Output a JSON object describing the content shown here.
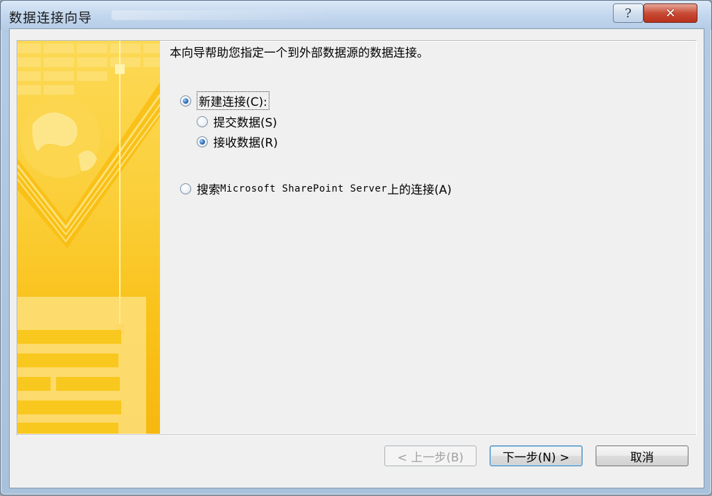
{
  "window": {
    "title": "数据连接向导",
    "help_label": "?",
    "close_label": "✕"
  },
  "wizard": {
    "intro": "本向导帮助您指定一个到外部数据源的数据连接。",
    "options": {
      "new_connection": "新建连接(C):",
      "submit_data": "提交数据(S)",
      "receive_data": "接收数据(R)",
      "search_prefix": "搜索 ",
      "search_product": "Microsoft SharePoint Server",
      "search_suffix": " 上的连接(A)"
    }
  },
  "buttons": {
    "back": "< 上一步(B)",
    "next": "下一步(N) >",
    "cancel": "取消"
  },
  "state": {
    "new_connection_selected": true,
    "receive_data_selected": true
  },
  "colors": {
    "banner_yellow": "#fbcf3a",
    "banner_light": "#fde27a",
    "close_red": "#c94c36"
  },
  "icons": {
    "help": "question-mark-icon",
    "close": "close-icon",
    "globe": "globe-icon"
  }
}
